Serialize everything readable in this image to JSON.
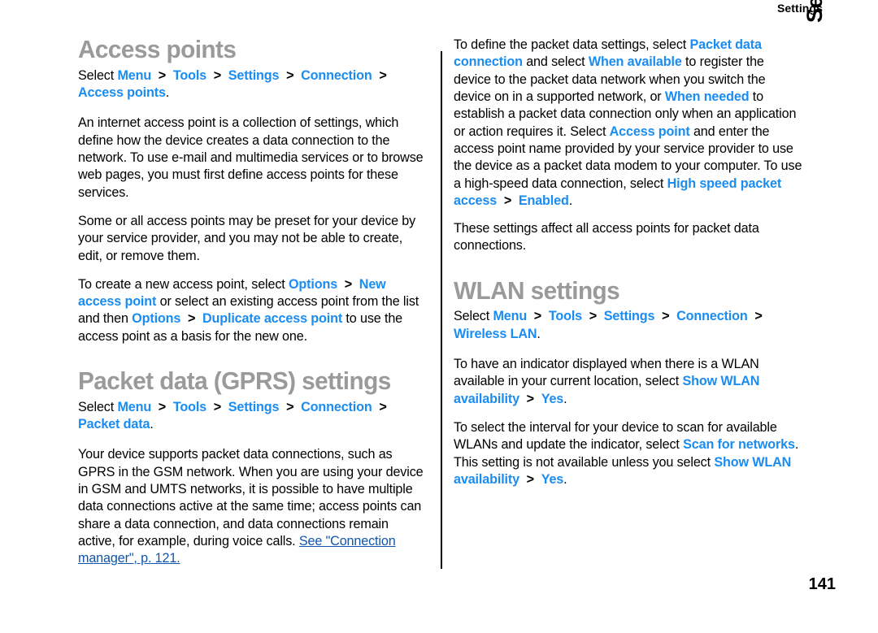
{
  "page": {
    "running_head": "Settings",
    "side_tab": "Settings",
    "number": "141",
    "colors": {
      "heading": "#9a9a9a",
      "ui_term": "#1b8cf0",
      "cross_reference": "#1155aa",
      "body": "#000000"
    }
  },
  "left_column": {
    "heading_access_points": "Access points",
    "path_access_points": {
      "lead": "Select ",
      "items": [
        "Menu",
        "Tools",
        "Settings",
        "Connection",
        "Access points"
      ],
      "separator": ">",
      "end": "."
    },
    "para_definition": "An internet access point is a collection of settings, which define how the device creates a data connection to the network. To use e-mail and multimedia services or to browse web pages, you must first define access points for these services.",
    "para_preset": "Some or all access points may be preset for your device by your service provider, and you may not be able to create, edit, or remove them.",
    "para_create": {
      "t1": "To create a new access point, select ",
      "ui1": "Options",
      "sep1": ">",
      "ui2": "New access point",
      "t2": " or select an existing access point from the list and then ",
      "ui3": "Options",
      "sep2": ">",
      "ui4": "Duplicate access point",
      "t3": " to use the access point as a basis for the new one."
    },
    "heading_packet_data": "Packet data (GPRS) settings",
    "path_packet_data": {
      "lead": "Select ",
      "items": [
        "Menu",
        "Tools",
        "Settings",
        "Connection",
        "Packet data"
      ],
      "separator": ">",
      "end": "."
    },
    "para_supports": {
      "t1": "Your device supports packet data connections, such as GPRS in the GSM network. When you are using your device in GSM and UMTS networks, it is possible to have multiple data connections active at the same time; access points can share a data connection, and data connections remain active, for example, during voice calls. ",
      "xref": "See \"Connection manager\", p. 121."
    }
  },
  "right_column": {
    "para_define": {
      "t1": "To define the packet data settings, select ",
      "ui1": "Packet data connection",
      "t2": " and select ",
      "ui2": "When available",
      "t3": " to register the device to the packet data network when you switch the device on in a supported network, or ",
      "ui3": "When needed",
      "t4": " to establish a packet data connection only when an application or action requires it. Select ",
      "ui4": "Access point",
      "t5": " and enter the access point name provided by your service provider to use the device as a packet data modem to your computer. To use a high-speed data connection, select ",
      "ui5": "High speed packet access",
      "sep1": ">",
      "ui6": "Enabled",
      "t6": "."
    },
    "para_affect": "These settings affect all access points for packet data connections.",
    "heading_wlan": "WLAN settings",
    "path_wlan": {
      "lead": "Select ",
      "items": [
        "Menu",
        "Tools",
        "Settings",
        "Connection",
        "Wireless LAN"
      ],
      "separator": ">",
      "end": "."
    },
    "para_indicator": {
      "t1": "To have an indicator displayed when there is a WLAN available in your current location, select ",
      "ui1": "Show WLAN availability",
      "sep1": ">",
      "ui2": "Yes",
      "t2": "."
    },
    "para_interval": {
      "t1": "To select the interval for your device to scan for available WLANs and update the indicator, select ",
      "ui1": "Scan for networks",
      "t2": ". This setting is not available unless you select ",
      "ui2": "Show WLAN availability",
      "sep1": ">",
      "ui3": "Yes",
      "t3": "."
    }
  }
}
